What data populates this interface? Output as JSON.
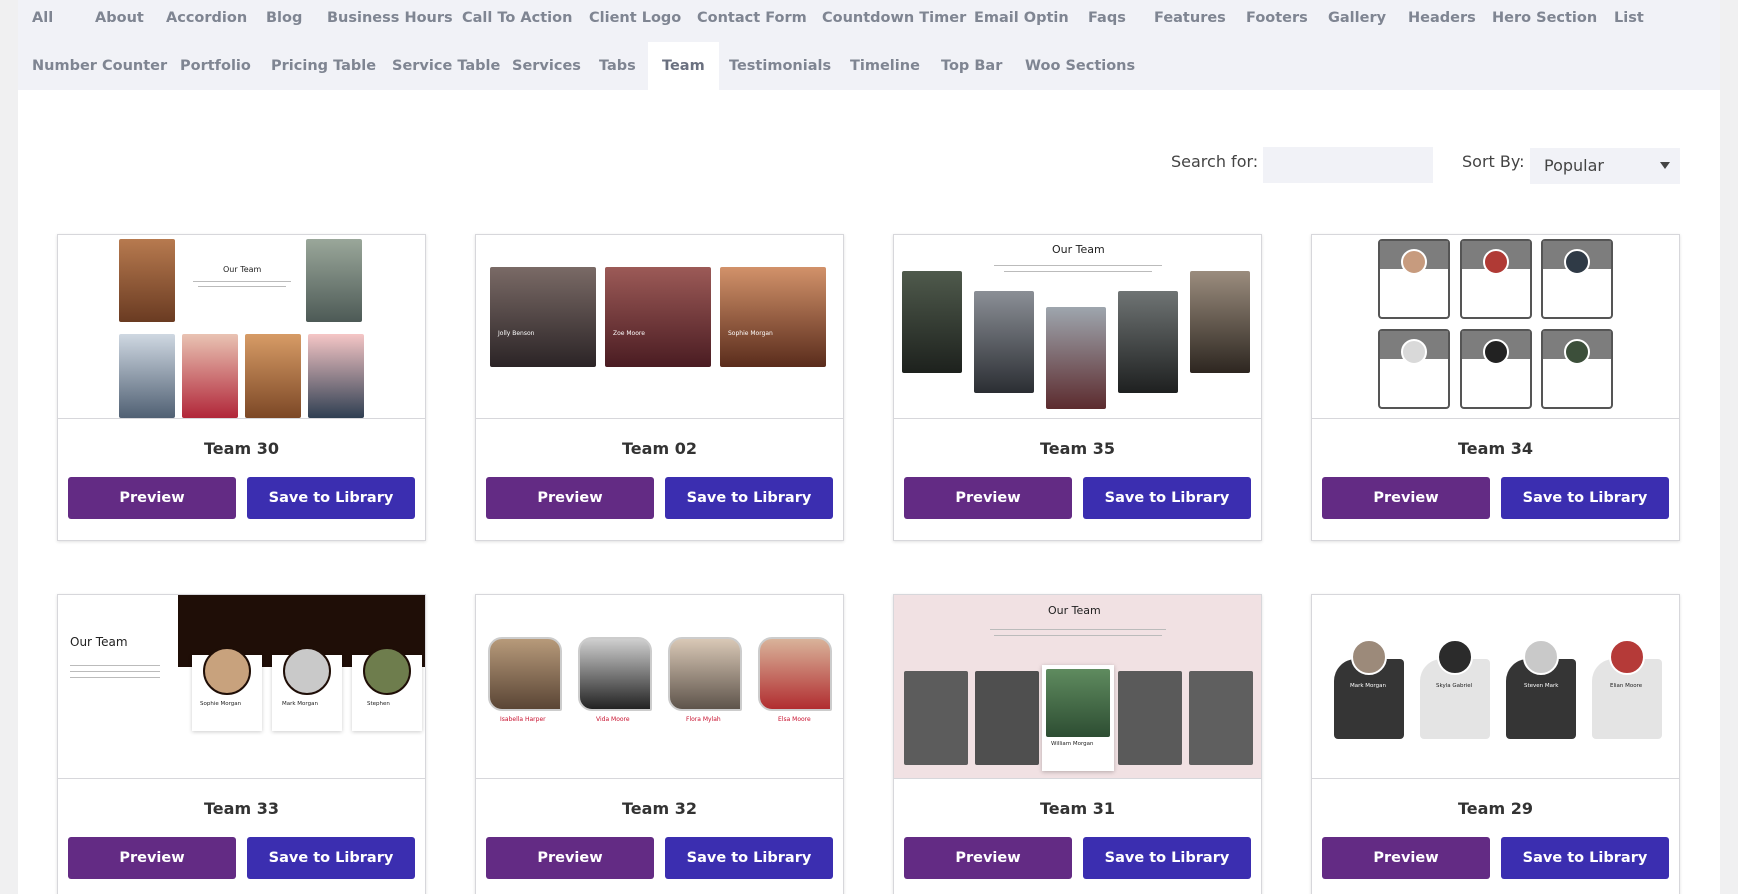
{
  "tabs": [
    {
      "label": "All"
    },
    {
      "label": "About"
    },
    {
      "label": "Accordion"
    },
    {
      "label": "Blog"
    },
    {
      "label": "Business Hours"
    },
    {
      "label": "Call To Action"
    },
    {
      "label": "Client Logo"
    },
    {
      "label": "Contact Form"
    },
    {
      "label": "Countdown Timer"
    },
    {
      "label": "Email Optin"
    },
    {
      "label": "Faqs"
    },
    {
      "label": "Features"
    },
    {
      "label": "Footers"
    },
    {
      "label": "Gallery"
    },
    {
      "label": "Headers"
    },
    {
      "label": "Hero Section"
    },
    {
      "label": "List"
    },
    {
      "label": "Number Counter"
    },
    {
      "label": "Portfolio"
    },
    {
      "label": "Pricing Table"
    },
    {
      "label": "Service Table"
    },
    {
      "label": "Services"
    },
    {
      "label": "Tabs"
    },
    {
      "label": "Team"
    },
    {
      "label": "Testimonials"
    },
    {
      "label": "Timeline"
    },
    {
      "label": "Top Bar"
    },
    {
      "label": "Woo Sections"
    }
  ],
  "active_tab": "Team",
  "search": {
    "label": "Search for:",
    "value": ""
  },
  "sort": {
    "label": "Sort By:",
    "selected": "Popular"
  },
  "cards": [
    {
      "title": "Team 30",
      "preview_label": "Preview",
      "save_label": "Save to Library",
      "thumb_heading": "Our Team"
    },
    {
      "title": "Team 02",
      "preview_label": "Preview",
      "save_label": "Save to Library",
      "members": [
        "Jolly Benson",
        "Zoe Moore",
        "Sophie Morgan"
      ]
    },
    {
      "title": "Team 35",
      "preview_label": "Preview",
      "save_label": "Save to Library",
      "thumb_heading": "Our Team"
    },
    {
      "title": "Team 34",
      "preview_label": "Preview",
      "save_label": "Save to Library"
    },
    {
      "title": "Team 33",
      "preview_label": "Preview",
      "save_label": "Save to Library",
      "thumb_heading": "Our Team",
      "members": [
        "Sophie Morgan",
        "Mark Morgan",
        "Stephen"
      ]
    },
    {
      "title": "Team 32",
      "preview_label": "Preview",
      "save_label": "Save to Library",
      "members": [
        "Isabella Harper",
        "Vida Moore",
        "Flora Mylah",
        "Elsa Moore"
      ]
    },
    {
      "title": "Team 31",
      "preview_label": "Preview",
      "save_label": "Save to Library",
      "thumb_heading": "Our Team",
      "members": [
        "William Morgan"
      ]
    },
    {
      "title": "Team 29",
      "preview_label": "Preview",
      "save_label": "Save to Library",
      "members": [
        "Mark Morgan",
        "Skyla Gabriel",
        "Steven Mark",
        "Elian Moore"
      ]
    }
  ],
  "colors": {
    "preview": "#632b84",
    "save": "#3b2eb0",
    "accent_red": "#c8102e"
  }
}
